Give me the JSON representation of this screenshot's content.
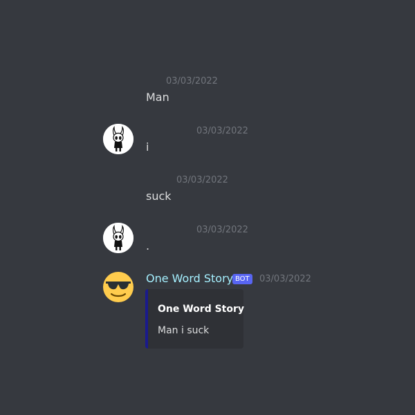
{
  "messages": [
    {
      "timestamp": "03/03/2022",
      "text": "Man"
    },
    {
      "timestamp": "03/03/2022",
      "text": "i",
      "avatar_icon": "hollow-knight-icon"
    },
    {
      "timestamp": "03/03/2022",
      "text": "suck"
    },
    {
      "timestamp": "03/03/2022",
      "text": ".",
      "avatar_icon": "hollow-knight-icon"
    }
  ],
  "bot_message": {
    "username": "One Word Story",
    "badge": "BOT",
    "timestamp": "03/03/2022",
    "avatar_icon": "sunglasses-emoji-icon",
    "embed": {
      "title": "One Word Story",
      "description": "Man i suck",
      "border_color": "#1a1a8c"
    }
  },
  "colors": {
    "background": "#36393f",
    "timestamp": "#72767d",
    "message_text": "#dcddde",
    "bot_name": "#a5f0ff",
    "bot_badge": "#5865f2",
    "embed_background": "#2f3136"
  }
}
